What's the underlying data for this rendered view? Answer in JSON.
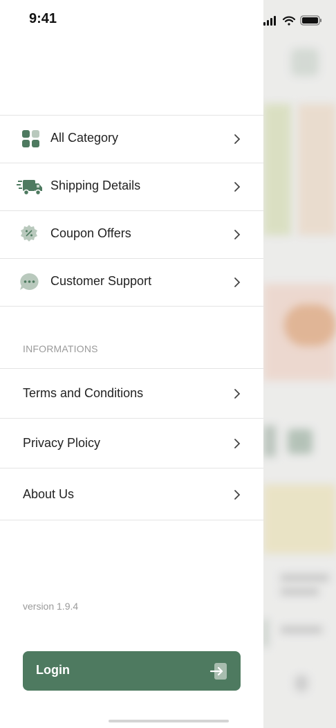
{
  "status_bar": {
    "time": "9:41"
  },
  "menu": {
    "items": [
      {
        "label": "All Category",
        "icon": "grid-icon"
      },
      {
        "label": "Shipping Details",
        "icon": "truck-icon"
      },
      {
        "label": "Coupon Offers",
        "icon": "coupon-icon"
      },
      {
        "label": "Customer Support",
        "icon": "chat-icon"
      }
    ]
  },
  "informations": {
    "title": "INFORMATIONS",
    "items": [
      {
        "label": "Terms and Conditions"
      },
      {
        "label": "Privacy Ploicy"
      },
      {
        "label": "About Us"
      }
    ]
  },
  "version": "version 1.9.4",
  "login": {
    "label": "Login",
    "icon": "login-arrow-icon"
  },
  "colors": {
    "accent": "#4e7a60",
    "divider": "#e4e4e4",
    "muted_text": "#9a9a9a"
  }
}
